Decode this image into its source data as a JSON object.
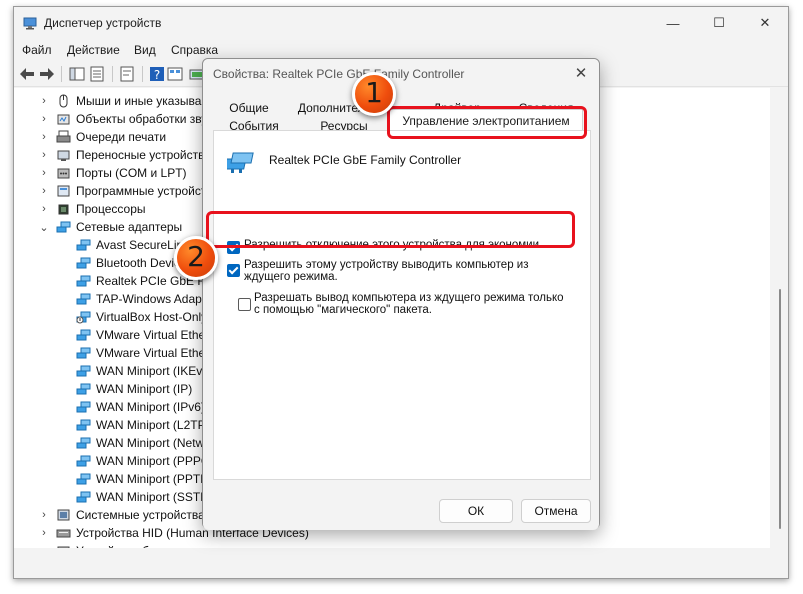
{
  "window": {
    "title": "Диспетчер устройств",
    "minimize": "—",
    "maximize": "☐",
    "close": "✕"
  },
  "menu": {
    "file": "Файл",
    "action": "Действие",
    "view": "Вид",
    "help": "Справка"
  },
  "tree": {
    "items": [
      {
        "chevron": "›",
        "label": "Мыши и иные указывающие устройства",
        "icon": "mouse-icon"
      },
      {
        "chevron": "›",
        "label": "Объекты обработки звука",
        "icon": "audio-processing-icon"
      },
      {
        "chevron": "›",
        "label": "Очереди печати",
        "icon": "printer-icon"
      },
      {
        "chevron": "›",
        "label": "Переносные устройства",
        "icon": "portable-device-icon"
      },
      {
        "chevron": "›",
        "label": "Порты (COM и LPT)",
        "icon": "port-icon"
      },
      {
        "chevron": "›",
        "label": "Программные устройства",
        "icon": "software-device-icon"
      },
      {
        "chevron": "›",
        "label": "Процессоры",
        "icon": "processor-icon"
      },
      {
        "chevron": "⌄",
        "label": "Сетевые адаптеры",
        "icon": "network-adapter-icon"
      },
      {
        "chevron": "",
        "label": "Avast SecureLine",
        "icon": "network-adapter-icon"
      },
      {
        "chevron": "",
        "label": "Bluetooth Device",
        "icon": "network-adapter-icon"
      },
      {
        "chevron": "",
        "label": "Realtek PCIe GbE Family Controller",
        "icon": "network-adapter-icon"
      },
      {
        "chevron": "",
        "label": "TAP-Windows Adapter",
        "icon": "network-adapter-icon"
      },
      {
        "chevron": "",
        "label": "VirtualBox Host-Only",
        "icon": "network-adapter-warning-icon"
      },
      {
        "chevron": "",
        "label": "VMware Virtual Ethernet",
        "icon": "network-adapter-icon"
      },
      {
        "chevron": "",
        "label": "VMware Virtual Ethernet",
        "icon": "network-adapter-icon"
      },
      {
        "chevron": "",
        "label": "WAN Miniport (IKEv2)",
        "icon": "network-adapter-icon"
      },
      {
        "chevron": "",
        "label": "WAN Miniport (IP)",
        "icon": "network-adapter-icon"
      },
      {
        "chevron": "",
        "label": "WAN Miniport (IPv6)",
        "icon": "network-adapter-icon"
      },
      {
        "chevron": "",
        "label": "WAN Miniport (L2TP)",
        "icon": "network-adapter-icon"
      },
      {
        "chevron": "",
        "label": "WAN Miniport (Network Monitor)",
        "icon": "network-adapter-icon"
      },
      {
        "chevron": "",
        "label": "WAN Miniport (PPPOE)",
        "icon": "network-adapter-icon"
      },
      {
        "chevron": "",
        "label": "WAN Miniport (PPTP)",
        "icon": "network-adapter-icon"
      },
      {
        "chevron": "",
        "label": "WAN Miniport (SSTP)",
        "icon": "network-adapter-icon"
      },
      {
        "chevron": "›",
        "label": "Системные устройства",
        "icon": "system-device-icon"
      },
      {
        "chevron": "›",
        "label": "Устройства HID (Human Interface Devices)",
        "icon": "hid-device-icon"
      },
      {
        "chevron": "›",
        "label": "Устройства безопасности",
        "icon": "security-device-icon"
      }
    ]
  },
  "dialog": {
    "title": "Свойства: Realtek PCIe GbE Family Controller",
    "close": "✕",
    "tabs_row1": [
      "Общие",
      "Дополнительно",
      "Драйвер",
      "Сведения"
    ],
    "tabs_row2": [
      "События",
      "Ресурсы"
    ],
    "active_tab": "Управление электропитанием",
    "device_name": "Realtek PCIe GbE Family Controller",
    "options": [
      {
        "label": "Разрешить отключение этого устройства для экономии энергии",
        "checked": true
      },
      {
        "label": "Разрешить этому устройству выводить компьютер из ждущего режима.",
        "checked": true
      },
      {
        "label": "Разрешать вывод компьютера из ждущего режима только с помощью \"магического\" пакета.",
        "checked": false
      }
    ],
    "ok_label": "ОК",
    "cancel_label": "Отмена"
  },
  "annotations": {
    "badge1": "1",
    "badge2": "2",
    "highlight_color": "#e8121d",
    "badge_color": "#ef4d0d"
  },
  "colors": {
    "accent": "#0067c0",
    "network_icon": "#2f8fd6"
  }
}
